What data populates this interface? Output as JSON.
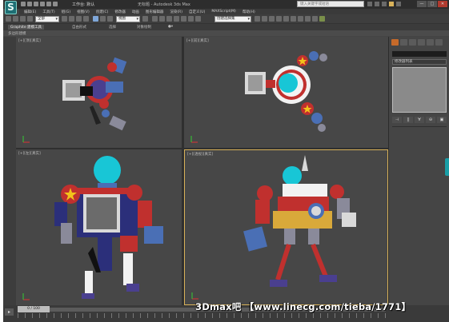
{
  "app": {
    "logo": "S",
    "workspace_label": "工作台: 默认",
    "title": "无标题 - Autodesk 3ds Max",
    "search_placeholder": "键入关键字或短语"
  },
  "window_buttons": [
    "—",
    "□",
    "✕"
  ],
  "menus": [
    "编辑(E)",
    "工具(T)",
    "组(G)",
    "视图(V)",
    "创建(C)",
    "修改器",
    "动画",
    "图形编辑器",
    "渲染(R)",
    "自定义(U)",
    "MAXScript(M)",
    "帮助(H)"
  ],
  "toolbar": {
    "selection_filter": "全部",
    "ref_coord": "视图",
    "named_selection": "创建选择集"
  },
  "ribbon": {
    "tabs": [
      "Graphite 建模工具",
      "自由形式",
      "选择",
      "对象绘制"
    ],
    "sub_label": "多边形建模"
  },
  "viewports": {
    "top": "[+][顶][真实]",
    "front": "[+][前][真实]",
    "left": "[+][左][真实]",
    "perspective": "[+][透视][真实]"
  },
  "command_panel": {
    "modifier_list": "修改器列表",
    "stack_buttons": [
      "⊣",
      "||",
      "∀",
      "⊖",
      "▣"
    ]
  },
  "timeline": {
    "frame": "0 / 100"
  },
  "watermark": "3Dmax吧 【www.linecg.com/tieba/1771】",
  "colors": {
    "bg": "#444444",
    "viewport": "#474747",
    "active_viewport_border": "#d9b25a",
    "robot_cyan": "#18c6d6",
    "robot_red": "#c0302e",
    "robot_blue": "#4a6fb5"
  }
}
